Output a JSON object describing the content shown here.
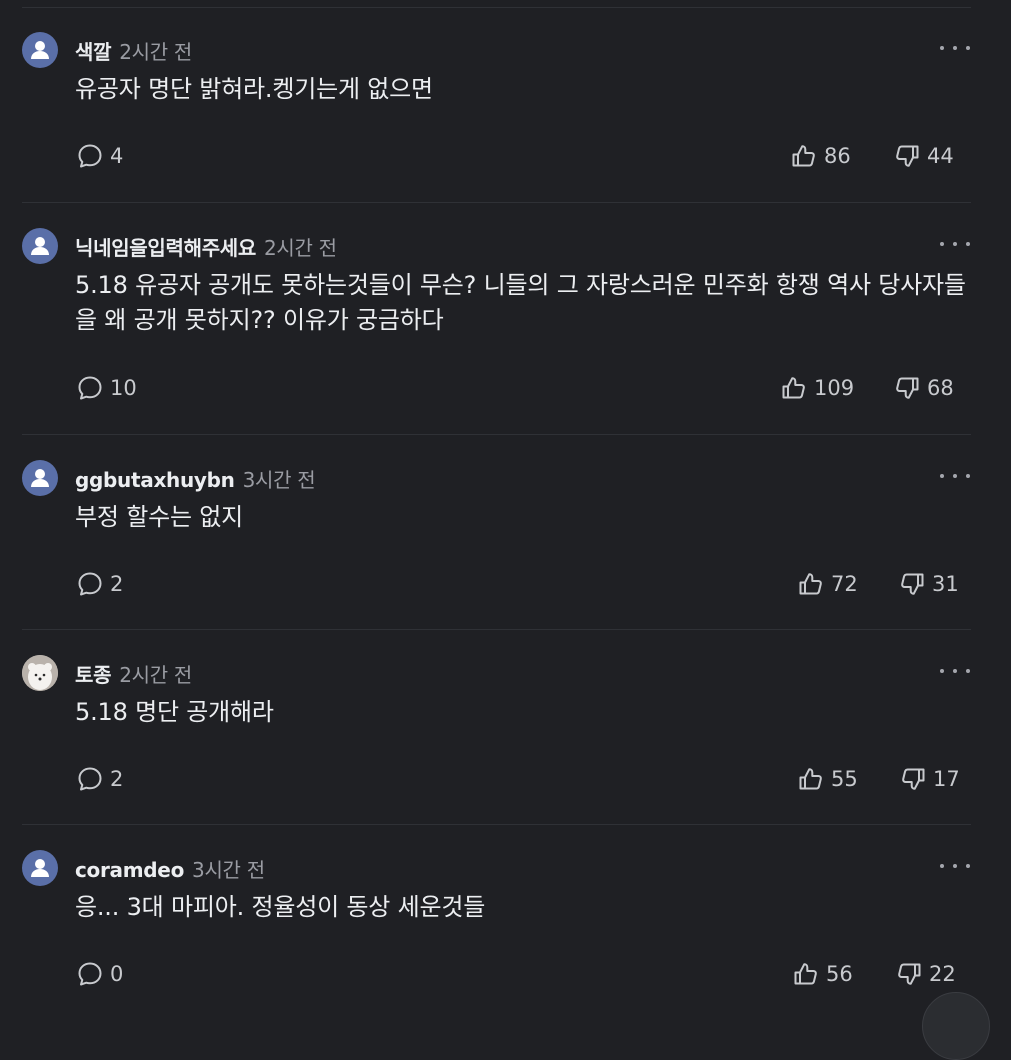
{
  "comments": [
    {
      "nickname": "색깔",
      "time": "2시간 전",
      "text": "유공자 명단 밝혀라.켕기는게 없으면",
      "replies": "4",
      "likes": "86",
      "dislikes": "44",
      "avatar": "default-avatar"
    },
    {
      "nickname": "닉네임을입력해주세요",
      "time": "2시간 전",
      "text": "5.18 유공자 공개도 못하는것들이 무슨? 니들의 그 자랑스러운 민주화 항쟁 역사 당사자들을 왜 공개 못하지?? 이유가 궁금하다",
      "replies": "10",
      "likes": "109",
      "dislikes": "68",
      "avatar": "default-avatar"
    },
    {
      "nickname": "ggbutaxhuybn",
      "time": "3시간 전",
      "text": "부정 할수는 없지",
      "replies": "2",
      "likes": "72",
      "dislikes": "31",
      "avatar": "default-avatar"
    },
    {
      "nickname": "토종",
      "time": "2시간 전",
      "text": "5.18 명단 공개해라",
      "replies": "2",
      "likes": "55",
      "dislikes": "17",
      "avatar": "photo-avatar"
    },
    {
      "nickname": "coramdeo",
      "time": "3시간 전",
      "text": "응... 3대 마피아. 정율성이 동상 세운것들",
      "replies": "0",
      "likes": "56",
      "dislikes": "22",
      "avatar": "default-avatar"
    }
  ],
  "colors": {
    "background": "#1f2024",
    "avatar": "#5a6fa8",
    "text": "#eceef1",
    "muted": "#9a9ca3"
  }
}
